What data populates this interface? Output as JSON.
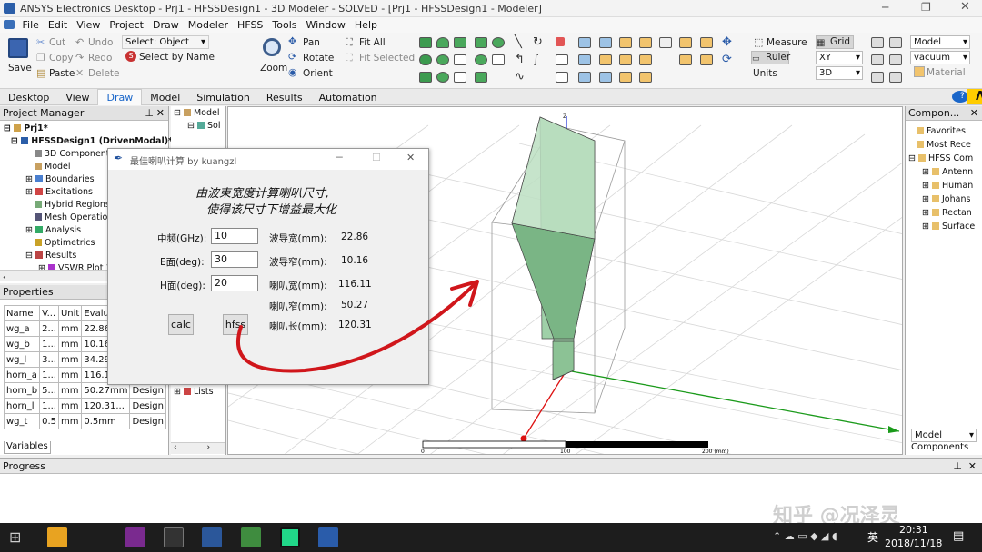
{
  "window": {
    "title": "ANSYS Electronics Desktop - Prj1 - HFSSDesign1 - 3D Modeler - SOLVED - [Prj1 - HFSSDesign1 - Modeler]"
  },
  "menu": [
    "File",
    "Edit",
    "View",
    "Project",
    "Draw",
    "Modeler",
    "HFSS",
    "Tools",
    "Window",
    "Help"
  ],
  "ribbon": {
    "save": "Save",
    "cut": "Cut",
    "copy": "Copy",
    "paste": "Paste",
    "undo": "Undo",
    "redo": "Redo",
    "delete": "Delete",
    "select_object": "Select: Object",
    "select_by_name": "Select by Name",
    "zoom": "Zoom",
    "pan": "Pan",
    "rotate": "Rotate",
    "orient": "Orient",
    "fit_all": "Fit All",
    "fit_selected": "Fit Selected",
    "measure": "Measure",
    "ruler": "Ruler",
    "units": "Units",
    "grid": "Grid",
    "plane": "XY",
    "dim": "3D",
    "model": "Model",
    "material": "vacuum",
    "material_btn": "Material"
  },
  "tabs": [
    "Desktop",
    "View",
    "Draw",
    "Model",
    "Simulation",
    "Results",
    "Automation"
  ],
  "project_manager": {
    "title": "Project Manager",
    "project": "Prj1*",
    "design": "HFSSDesign1 (DrivenModal)*",
    "items": [
      "3D Components",
      "Model",
      "Boundaries",
      "Excitations",
      "Hybrid Regions",
      "Mesh Operations",
      "Analysis",
      "Optimetrics",
      "Results",
      "VSWR Plot 1"
    ]
  },
  "properties": {
    "title": "Properties",
    "headers": [
      "Name",
      "V...",
      "Unit",
      "Evalua"
    ],
    "rows": [
      [
        "wg_a",
        "2...",
        "mm",
        "22.86m",
        ""
      ],
      [
        "wg_b",
        "1...",
        "mm",
        "10.16m",
        ""
      ],
      [
        "wg_l",
        "3...",
        "mm",
        "34.29m",
        ""
      ],
      [
        "horn_a",
        "1...",
        "mm",
        "116.11",
        ""
      ],
      [
        "horn_b",
        "5...",
        "mm",
        "50.27mm",
        "Design"
      ],
      [
        "horn_l",
        "1...",
        "mm",
        "120.31...",
        "Design"
      ],
      [
        "wg_t",
        "0.5",
        "mm",
        "0.5mm",
        "Design"
      ]
    ],
    "tab": "Variables"
  },
  "model_tree": {
    "items": [
      "Model",
      "Sol",
      "Lists"
    ]
  },
  "viewport": {
    "scale_labels": [
      "0",
      "100",
      "200 (mm)"
    ],
    "axis_z": "z"
  },
  "components": {
    "title": "Compon...",
    "items": [
      "Favorites",
      "Most Rece",
      "HFSS Com",
      "Antenn",
      "Human",
      "Johans",
      "Rectan",
      "Surface"
    ],
    "select": "Model",
    "tab": "Components"
  },
  "progress": {
    "title": "Progress"
  },
  "dialog": {
    "title": "最佳喇叭计算 by kuangzl",
    "heading1": "由波束宽度计算喇叭尺寸,",
    "heading2": "使得该尺寸下增益最大化",
    "freq_label": "中频(GHz):",
    "freq_value": "10",
    "e_label": "E面(deg):",
    "e_value": "30",
    "h_label": "H面(deg):",
    "h_value": "20",
    "results": [
      {
        "label": "波导宽(mm):",
        "value": "22.86"
      },
      {
        "label": "波导窄(mm):",
        "value": "10.16"
      },
      {
        "label": "喇叭宽(mm):",
        "value": "116.11"
      },
      {
        "label": "喇叭窄(mm):",
        "value": "50.27"
      },
      {
        "label": "喇叭长(mm):",
        "value": "120.31"
      }
    ],
    "calc_button": "calc",
    "hfss_button": "hfss"
  },
  "taskbar": {
    "time": "20:31",
    "date": "2018/11/18",
    "ime": "英"
  },
  "watermark": "知乎 @况泽灵",
  "colors": {
    "accent": "#1a66c9",
    "horn_face": "#8fc79b",
    "annotation": "#d0161b"
  }
}
